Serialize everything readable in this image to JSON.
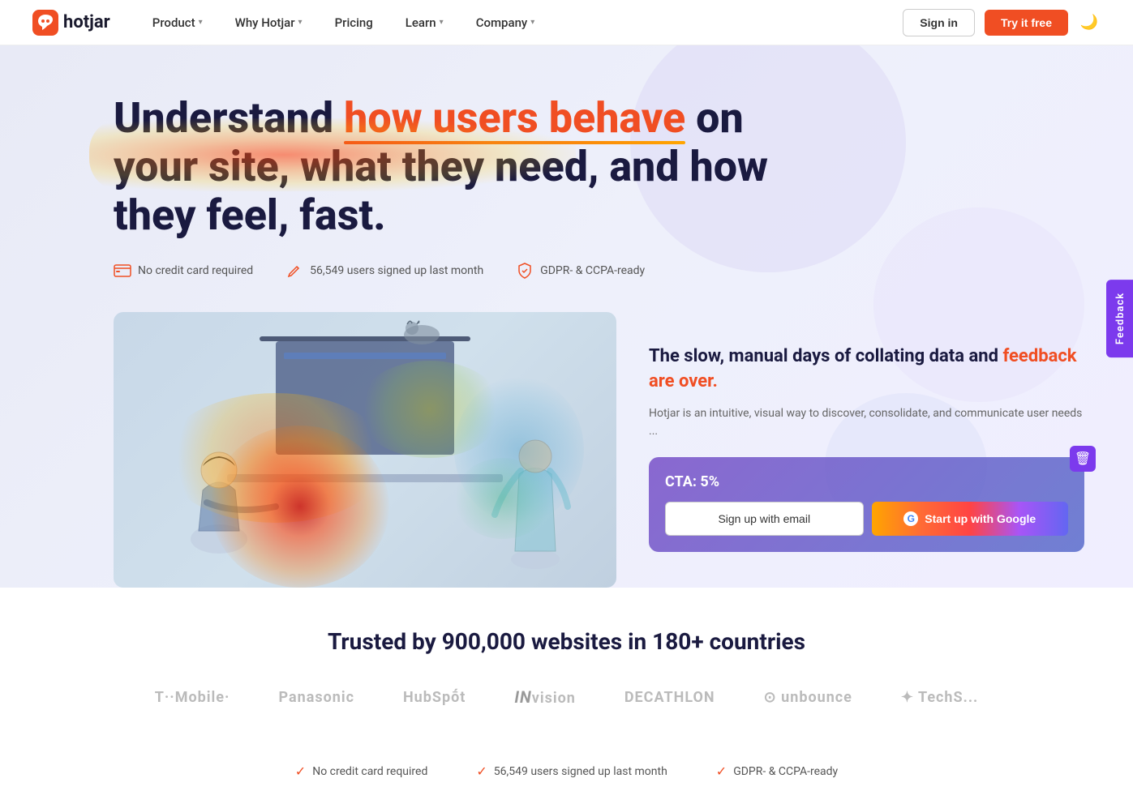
{
  "nav": {
    "logo_text": "hotjar",
    "items": [
      {
        "id": "product",
        "label": "Product",
        "has_dropdown": true
      },
      {
        "id": "why-hotjar",
        "label": "Why Hotjar",
        "has_dropdown": true
      },
      {
        "id": "pricing",
        "label": "Pricing",
        "has_dropdown": false
      },
      {
        "id": "learn",
        "label": "Learn",
        "has_dropdown": true
      },
      {
        "id": "company",
        "label": "Company",
        "has_dropdown": true
      }
    ],
    "signin_label": "Sign in",
    "try_free_label": "Try it free"
  },
  "hero": {
    "title_part1": "Un",
    "title_part2": "derstand ",
    "title_highlight": "how users behave",
    "title_part3": " on your site, what they need, and how they feel, fast.",
    "badge1": "No credit card required",
    "badge2": "56,549 users signed up last month",
    "badge3": "GDPR- & CCPA-ready",
    "subtitle_part1": "The slow, manual days of collating data and ",
    "subtitle_highlight": "feedback are over.",
    "description": "Hotjar is an intuitive, visual way to discover, consolidate, and communicate user needs ...",
    "cta_label": "CTA: 5%",
    "cta_email_label": "Sign up with email",
    "cta_google_label": "Start up with Google"
  },
  "trusted": {
    "title": "Trusted by 900,000 websites in 180+ countries",
    "logos": [
      "T··Mobile·",
      "Panasonic",
      "HubSpot",
      "INvision",
      "DECATHLON",
      "unbounce",
      "TechS..."
    ]
  },
  "footer_badges": {
    "badge1": "No credit card required",
    "badge2": "56,549 users signed up last month",
    "badge3": "GDPR- & CCPA-ready"
  },
  "feedback": {
    "tab_label": "Feedback"
  },
  "colors": {
    "brand_orange": "#f04e23",
    "brand_purple": "#7c3aed",
    "nav_bg": "#ffffff",
    "hero_bg": "#eef0f8"
  }
}
